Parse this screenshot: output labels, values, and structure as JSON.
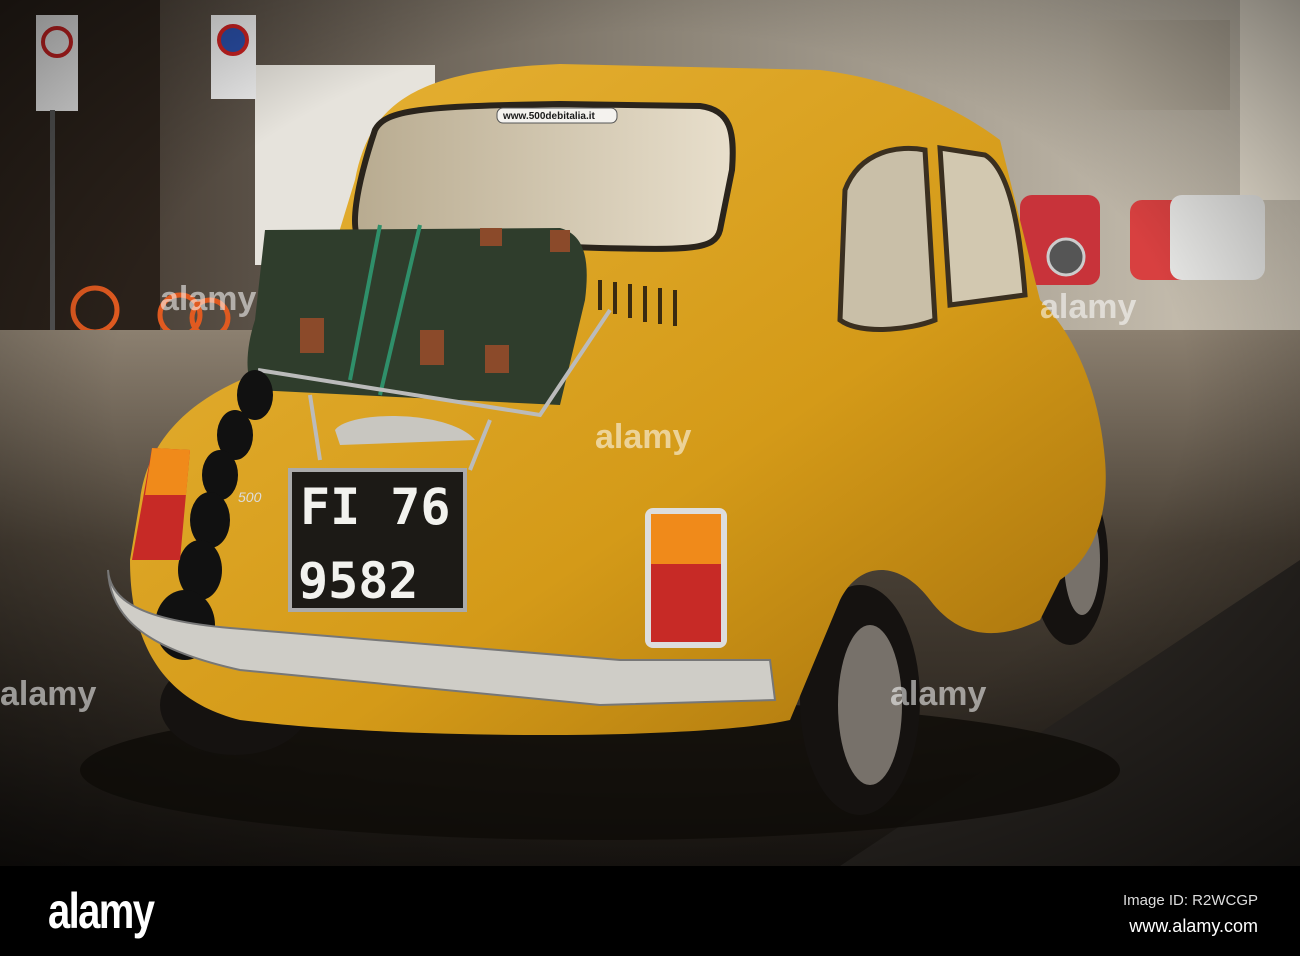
{
  "photo": {
    "subject": "Yellow Fiat 500 with suitcase on rear rack",
    "license_plate": {
      "line1": "FI 76",
      "line2": "9582"
    },
    "badge": "500",
    "window_sticker": "www.500debitalia.it",
    "watermark": "alamy",
    "colors": {
      "car": "#d9a21a",
      "suitcase": "#2f3d2c",
      "street": "#3a342c"
    }
  },
  "footer": {
    "logo": "alamy",
    "image_id": "Image ID: R2WCGP",
    "website": "www.alamy.com"
  }
}
